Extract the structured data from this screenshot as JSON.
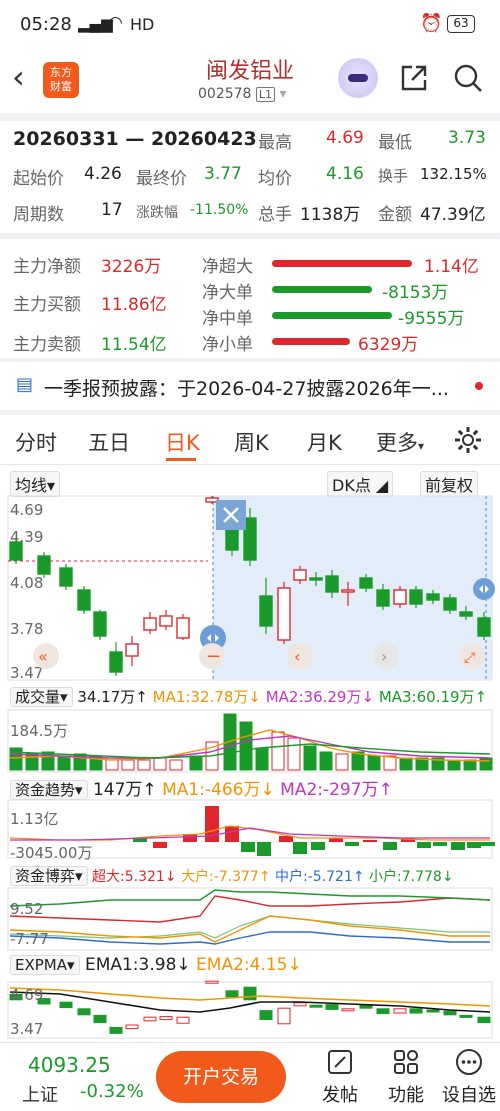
{
  "status": {
    "time": "05:28",
    "net": "HD",
    "battery": "63"
  },
  "header": {
    "title": "闽发铝业",
    "code": "002578",
    "level": "L1",
    "logo_line1": "东方",
    "logo_line2": "财富"
  },
  "summary": {
    "range": "20260331 — 20260423",
    "high_label": "最高",
    "high": "4.69",
    "low_label": "最低",
    "low": "3.73",
    "start_label": "起始价",
    "start": "4.26",
    "end_label": "最终价",
    "end": "3.77",
    "avg_label": "均价",
    "avg": "4.16",
    "turnover_label": "换手",
    "turnover": "132.15%",
    "periods_label": "周期数",
    "periods": "17",
    "chg_label": "涨跌幅",
    "chg": "-11.50%",
    "vol_label": "总手",
    "vol": "1138万",
    "amt_label": "金额",
    "amt": "47.39亿"
  },
  "flow": {
    "net_label": "主力净额",
    "net": "3226万",
    "buy_label": "主力买额",
    "buy": "11.86亿",
    "sell_label": "主力卖额",
    "sell": "11.54亿",
    "items": [
      {
        "label": "净超大",
        "value": "1.14亿",
        "color": "#e0262c"
      },
      {
        "label": "净大单",
        "value": "-8153万",
        "color": "#1a9a2a"
      },
      {
        "label": "净中单",
        "value": "-9555万",
        "color": "#1a9a2a"
      },
      {
        "label": "净小单",
        "value": "6329万",
        "color": "#e0262c"
      }
    ]
  },
  "notice": {
    "text": "一季报预披露：于2026-04-27披露2026年一..."
  },
  "tabs": [
    "分时",
    "五日",
    "日K",
    "周K",
    "月K",
    "更多"
  ],
  "chart_toolbar": {
    "ma_select": "均线",
    "dk": "DK点",
    "fq": "前复权"
  },
  "price_axis": {
    "labels": [
      "4.69",
      "4.39",
      "4.08",
      "3.78",
      "3.47"
    ]
  },
  "volume": {
    "select": "成交量",
    "value": "34.17万↑",
    "ma1": "MA1:32.78万↓",
    "ma2": "MA2:36.29万↓",
    "ma3": "MA3:60.19万↑",
    "axis": "184.5万"
  },
  "capital": {
    "select": "资金趋势",
    "value": "147万↑",
    "ma1": "MA1:-466万↓",
    "ma2": "MA2:-297万↑",
    "axis_top": "1.13亿",
    "axis_bottom": "-3045.00万"
  },
  "game": {
    "select": "资金博弈",
    "super": "超大:5.321↓",
    "big": "大户:-7.377↑",
    "mid": "中户:-5.721↑",
    "small": "小户:7.778↓",
    "axis_top": "9.52",
    "axis_bottom": "-7.77"
  },
  "expma": {
    "select": "EXPMA",
    "ema1": "EMA1:3.98↓",
    "ema2": "EMA2:4.15↓",
    "axis_top": "4.69",
    "axis_bottom": "3.47"
  },
  "bottom": {
    "index_value": "4093.25",
    "index_name": "上证",
    "index_chg": "-0.32%",
    "trade": "开户交易",
    "post": "发帖",
    "func": "功能",
    "alert": "设自选"
  },
  "colors": {
    "up": "#e0262c",
    "down": "#1a9a2a",
    "accent": "#f25a1c"
  }
}
